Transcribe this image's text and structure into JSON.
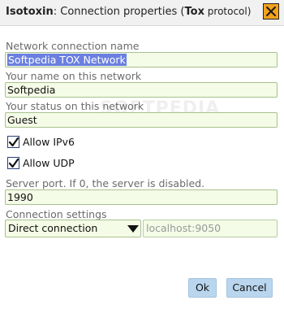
{
  "window": {
    "app_name": "Isotoxin",
    "title_mid": ": Connection properties (",
    "protocol": "Tox",
    "protocol_suffix": " protocol)",
    "close_icon": "close-icon",
    "accent": "#f3a21b"
  },
  "form": {
    "network_name_label": "Network connection name",
    "network_name_value": "Softpedia TOX Network",
    "your_name_label": "Your name on this network",
    "your_name_value": "Softpedia",
    "status_label": "Your status on this network",
    "status_value": "Guest",
    "allow_ipv6_label": "Allow IPv6",
    "allow_ipv6_checked": true,
    "allow_udp_label": "Allow UDP",
    "allow_udp_checked": true,
    "server_port_label": "Server port. If 0, the server is disabled.",
    "server_port_value": "1990",
    "connection_settings_label": "Connection settings",
    "connection_type": "Direct connection",
    "proxy_address_placeholder": "localhost:9050"
  },
  "buttons": {
    "ok_label": "Ok",
    "cancel_label": "Cancel"
  },
  "watermark": "SOFTPEDIA"
}
